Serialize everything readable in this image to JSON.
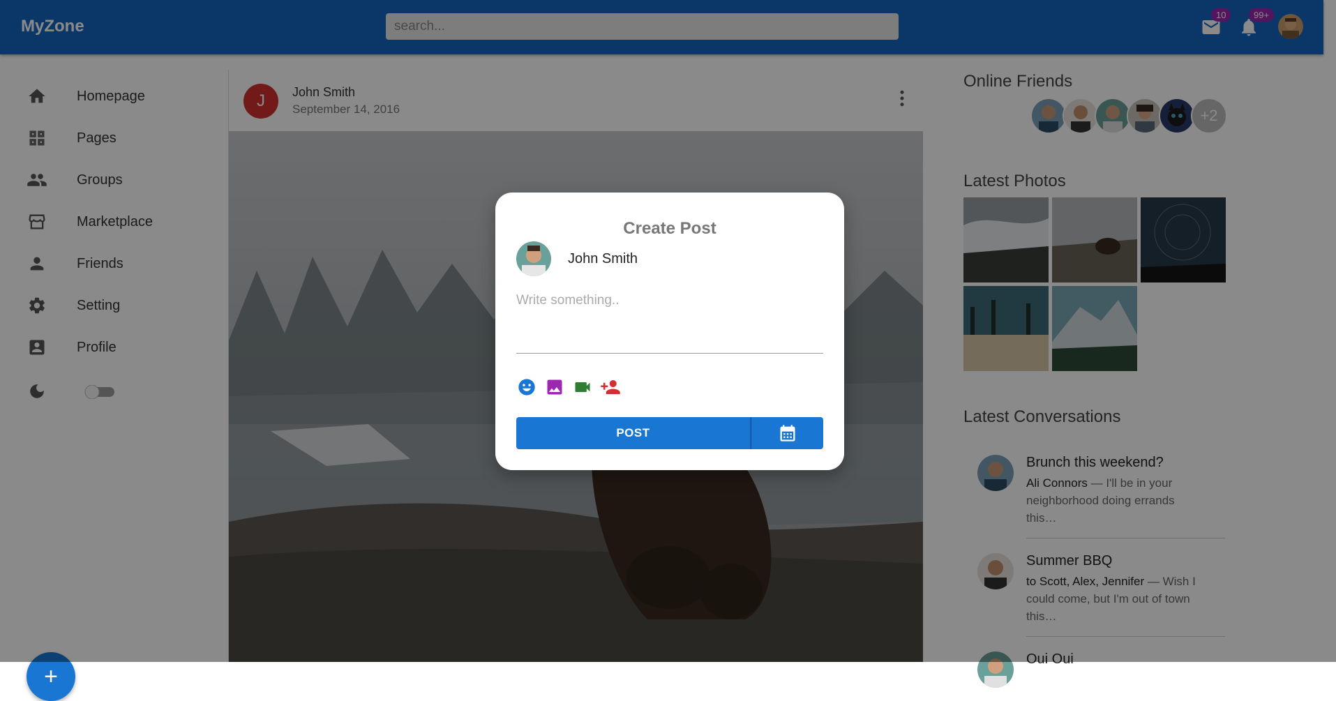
{
  "app": {
    "title": "MyZone"
  },
  "search": {
    "placeholder": "search..."
  },
  "topbar": {
    "mail_badge": "10",
    "notifications_badge": "99+"
  },
  "sidebar": {
    "items": [
      {
        "label": "Homepage",
        "icon": "home-icon"
      },
      {
        "label": "Pages",
        "icon": "pages-icon"
      },
      {
        "label": "Groups",
        "icon": "groups-icon"
      },
      {
        "label": "Marketplace",
        "icon": "storefront-icon"
      },
      {
        "label": "Friends",
        "icon": "person-icon"
      },
      {
        "label": "Setting",
        "icon": "gear-icon"
      },
      {
        "label": "Profile",
        "icon": "profile-card-icon"
      }
    ],
    "dark_mode": false
  },
  "fab": {
    "label": "+"
  },
  "post": {
    "avatar_letter": "J",
    "author": "John Smith",
    "date": "September 14, 2016"
  },
  "right": {
    "online_friends_title": "Online Friends",
    "online_friends_more": "+2",
    "latest_photos_title": "Latest Photos",
    "latest_conversations_title": "Latest Conversations",
    "conversations": [
      {
        "title": "Brunch this weekend?",
        "sender": "Ali Connors",
        "snippet": " — I'll be in your neighborhood doing errands this…"
      },
      {
        "title": "Summer BBQ",
        "sender": "to Scott, Alex, Jennifer",
        "snippet": " — Wish I could come, but I'm out of town this…"
      },
      {
        "title": "Oui Oui",
        "sender": "",
        "snippet": ""
      }
    ]
  },
  "dialog": {
    "title": "Create Post",
    "user_name": "John Smith",
    "input_placeholder": "Write something..",
    "post_button": "POST",
    "colors": {
      "emoji": "#1976d2",
      "image": "#9c27b0",
      "video": "#2e7d32",
      "tag": "#d32f2f"
    }
  }
}
